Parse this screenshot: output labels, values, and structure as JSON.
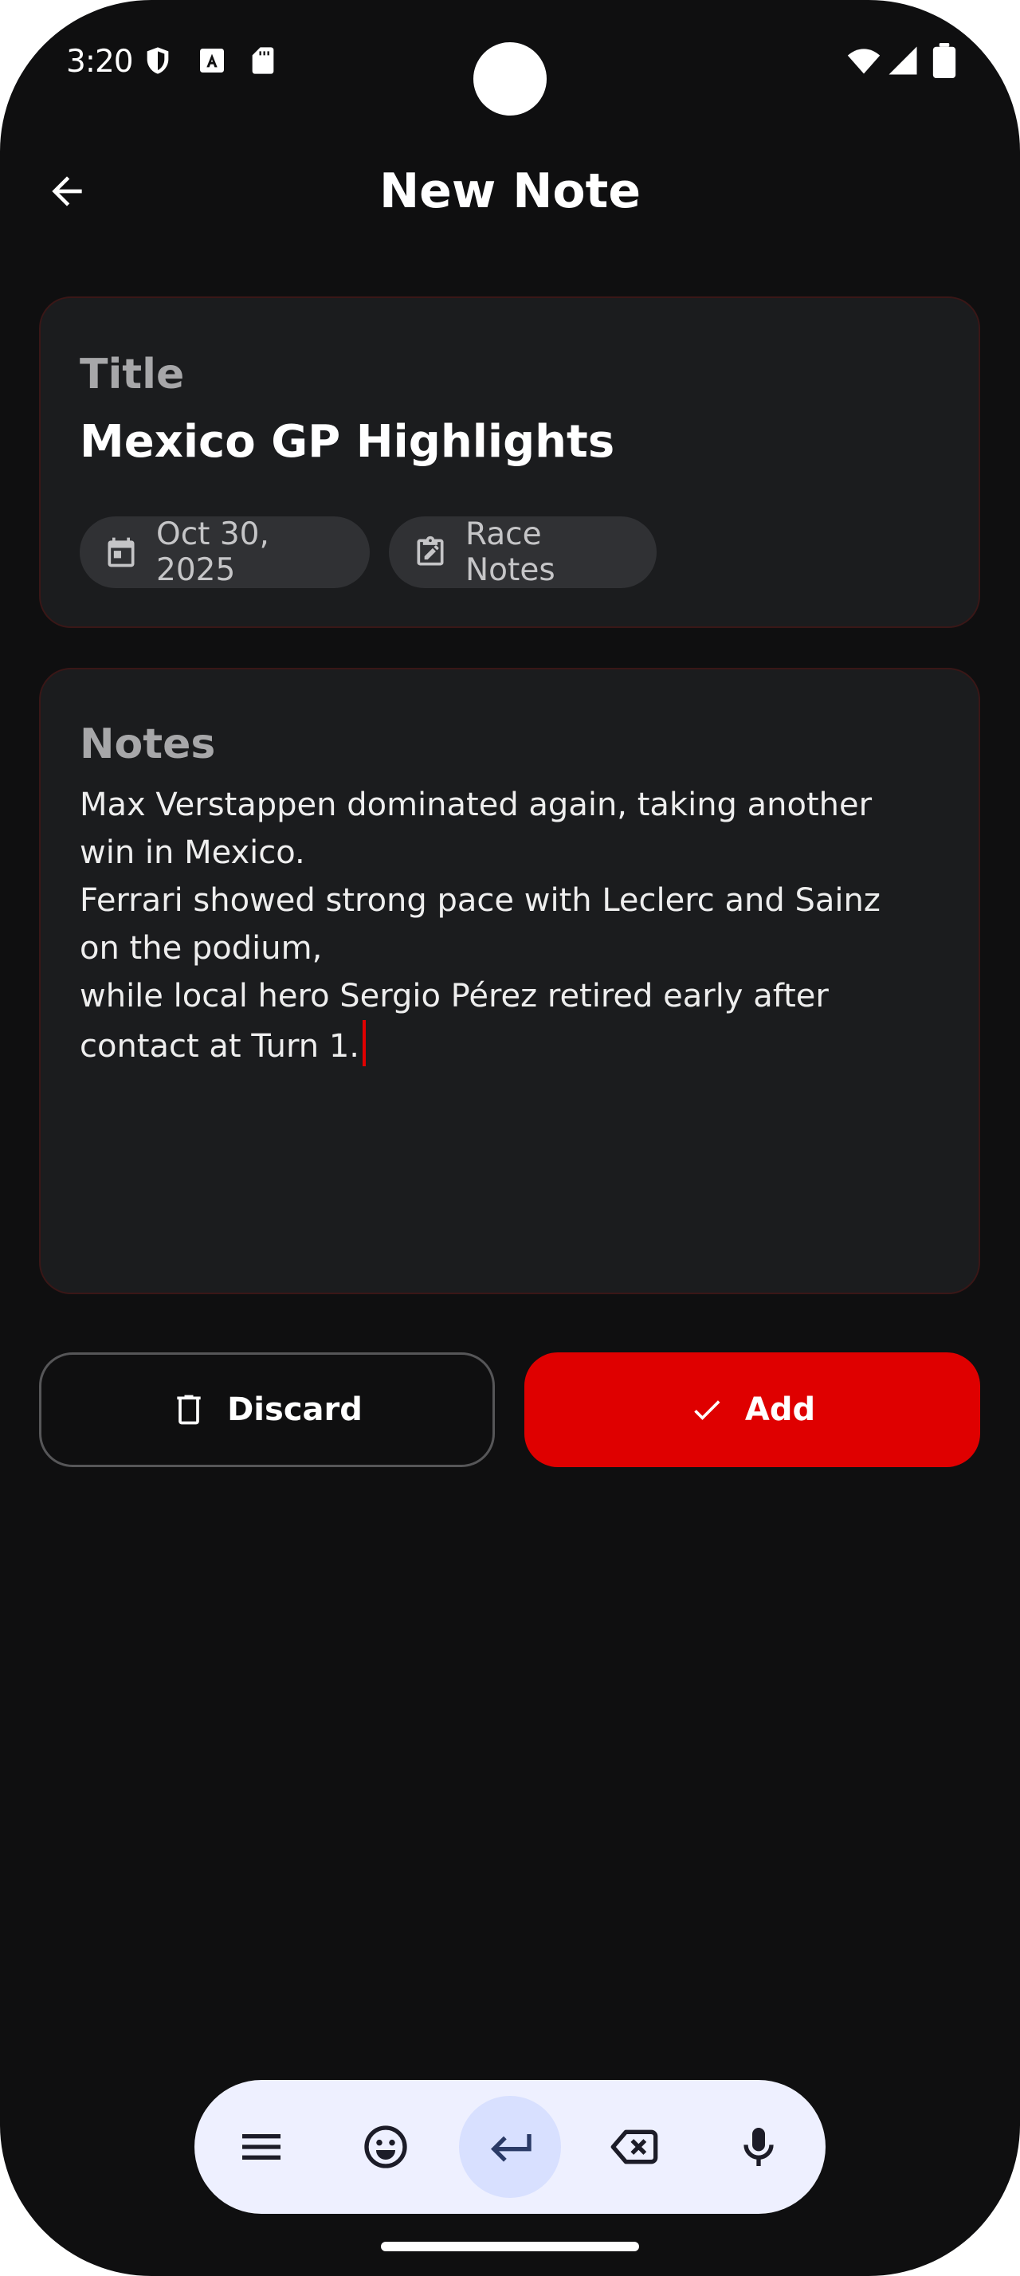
{
  "status_bar": {
    "time": "3:20",
    "left_icons": [
      "shield-icon",
      "font-a-icon",
      "sd-card-icon"
    ],
    "right_icons": [
      "wifi-icon",
      "cellular-signal-icon",
      "battery-icon"
    ]
  },
  "header": {
    "title": "New Note",
    "back_icon": "arrow-back-icon"
  },
  "title_card": {
    "label": "Title",
    "value": "Mexico GP Highlights",
    "date_chip": {
      "icon": "calendar-icon",
      "label": "Oct 30, 2025"
    },
    "category_chip": {
      "icon": "edit-clipboard-icon",
      "label": "Race Notes"
    }
  },
  "notes_card": {
    "label": "Notes",
    "lines": [
      "Max Verstappen dominated again, taking another",
      "win in Mexico.",
      "Ferrari showed strong pace with Leclerc and Sainz",
      "on the podium,",
      "while local hero Sergio Pérez retired early after",
      "contact at Turn 1."
    ]
  },
  "actions": {
    "discard_label": "Discard",
    "discard_icon": "trash-icon",
    "add_label": "Add",
    "add_icon": "check-icon"
  },
  "keyboard_toolbar": {
    "keys": [
      "menu-icon",
      "emoji-icon",
      "enter-icon",
      "backspace-icon",
      "microphone-icon"
    ],
    "active_key": "enter-icon"
  },
  "colors": {
    "background": "#0f0f10",
    "card": "#1b1c1e",
    "card_border": "#3a1717",
    "accent": "#df0000",
    "chip": "#303134",
    "label": "#a7a7a9",
    "toolbar": "#eef0ff",
    "toolbar_active": "#d8e0ff"
  }
}
